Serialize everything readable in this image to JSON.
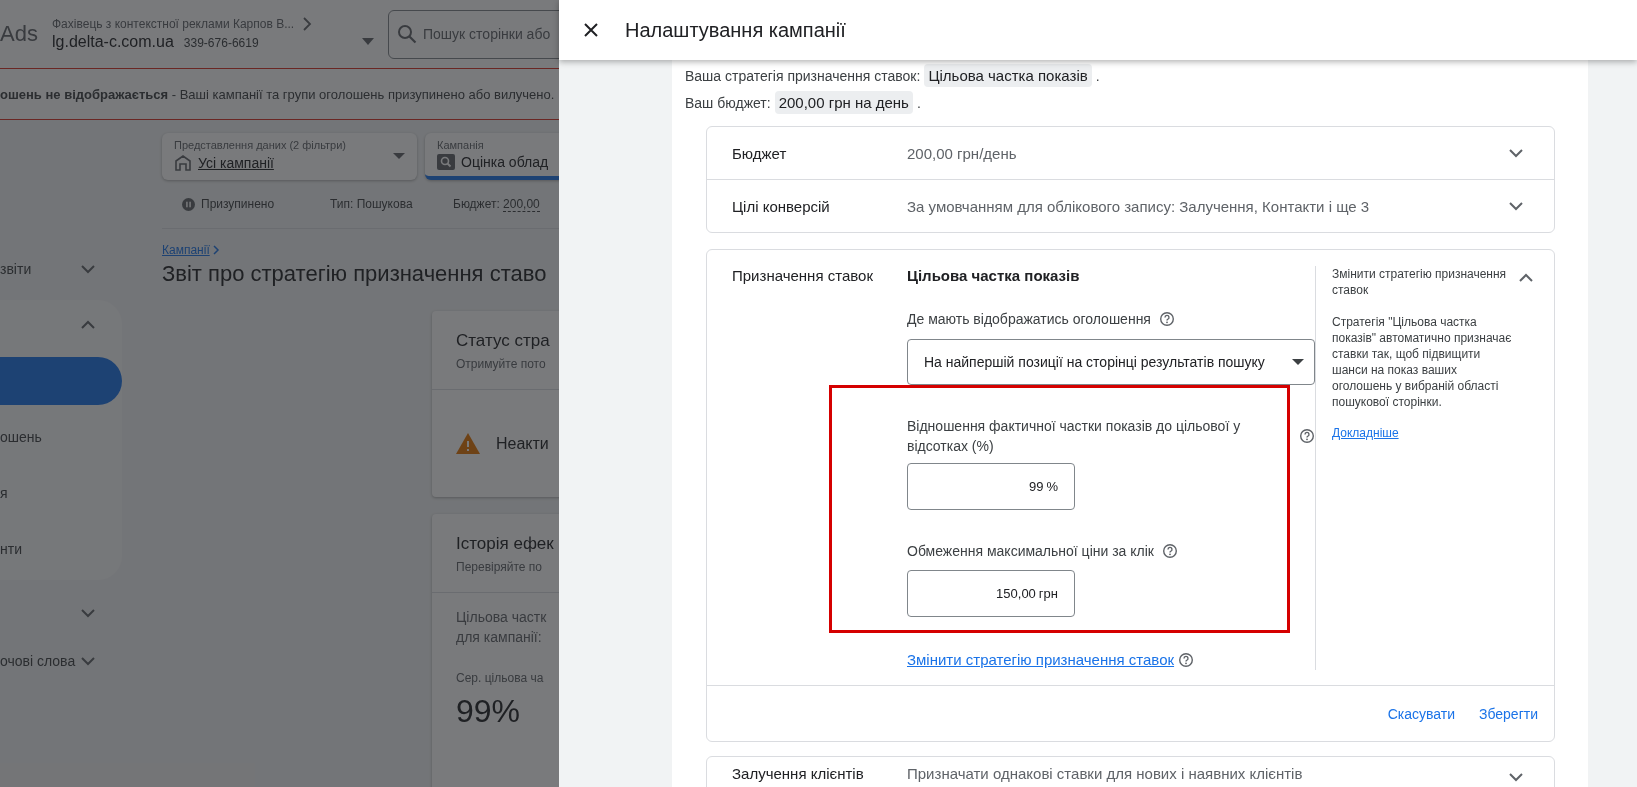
{
  "background": {
    "top_bar": {
      "logo": "Ads",
      "account_name": "Фахівець з контекстної реклами Карпов В...",
      "domain": "lg.delta-c.com.ua",
      "customer_id": "339-676-6619",
      "search": {
        "placeholder": "Пошук сторінки або"
      }
    },
    "alert": {
      "text": "**ошень не відображається** - Ваші кампанії та групи оголошень призупинено або вилучено."
    },
    "sidebar": [
      {
        "label": "звіти",
        "expanded": false
      },
      {
        "expanded": true,
        "items": [
          {
            "selected": true
          },
          {
            "label": "ошень",
            "selected": false
          },
          {
            "label": "я",
            "selected": false
          },
          {
            "label": "нти",
            "selected": false
          }
        ]
      },
      {
        "expanded": false
      },
      {
        "label": "очові слова",
        "expanded": false
      }
    ],
    "filters": [
      {
        "kind": "view",
        "label": "Представлення даних (2 фільтри)",
        "value": "Усі кампанії",
        "selected": false
      },
      {
        "kind": "campaign",
        "label": "Кампанія",
        "value": "Оцінка облад",
        "selected": true
      }
    ],
    "status_row": {
      "status": "Призупинено",
      "type_label": "Тип:",
      "type_value": "Пошукова",
      "budget_label": "Бюджет:",
      "budget_value": "200,00"
    },
    "breadcrumb": "Кампанії",
    "page_title": "Звіт про стратегію призначення ставо",
    "cards": [
      {
        "kind": "status",
        "title": "Статус стра",
        "subtitle": "Отримуйте пото",
        "status": "Неакти"
      },
      {
        "kind": "history",
        "title": "Історія ефек",
        "subtitle": "Перевіряйте по",
        "lines": [
          "Цільова частк",
          "для кампанії:"
        ],
        "metric_label": "Сер. цільова ча",
        "metric_value": "99%"
      }
    ]
  },
  "dialog": {
    "title": "Налаштування кампанії",
    "summary": [
      {
        "label": "Ваша стратегія призначення ставок:",
        "value": "Цільова частка показів",
        "suffix": "."
      },
      {
        "label": "Ваш бюджет:",
        "value": "200,00 грн на день",
        "suffix": "."
      }
    ],
    "settings": [
      {
        "name": "Бюджет",
        "value": "200,00 грн/день",
        "expanded": false
      },
      {
        "name": "Цілі конверсій",
        "value": "За умовчанням для облікового запису: Залучення, Контакти і ще 3",
        "expanded": false
      }
    ],
    "bidding": {
      "name": "Призначення ставок",
      "expanded": true,
      "highlighted": true,
      "strategy": "Цільова частка показів",
      "placement_label": "Де мають відображатись оголошення",
      "placement_value": "На найпершій позиції на сторінці результатів пошуку",
      "share_label": "Відношення фактичної частки показів до цільової у відсотках (%)",
      "share_value": "99",
      "share_unit": "%",
      "max_cpc_label": "Обмеження максимальної ціни за клік",
      "max_cpc_value": "150,00",
      "max_cpc_unit": "грн",
      "change_link": "Змінити стратегію призначення ставок",
      "help_title": "Змінити стратегію призначення ставок",
      "help_text": "Стратегія \"Цільова частка показів\" автоматично призначає ставки так, щоб підвищити шанси на показ ваших оголошень у вибраній області пошукової сторінки.",
      "help_link": "Докладніше",
      "actions": [
        "Скасувати",
        "Зберегти"
      ]
    },
    "next_setting": {
      "name": "Залучення клієнтів",
      "value": "Призначати однакові ставки для нових і наявних клієнтів",
      "expanded": false
    }
  }
}
